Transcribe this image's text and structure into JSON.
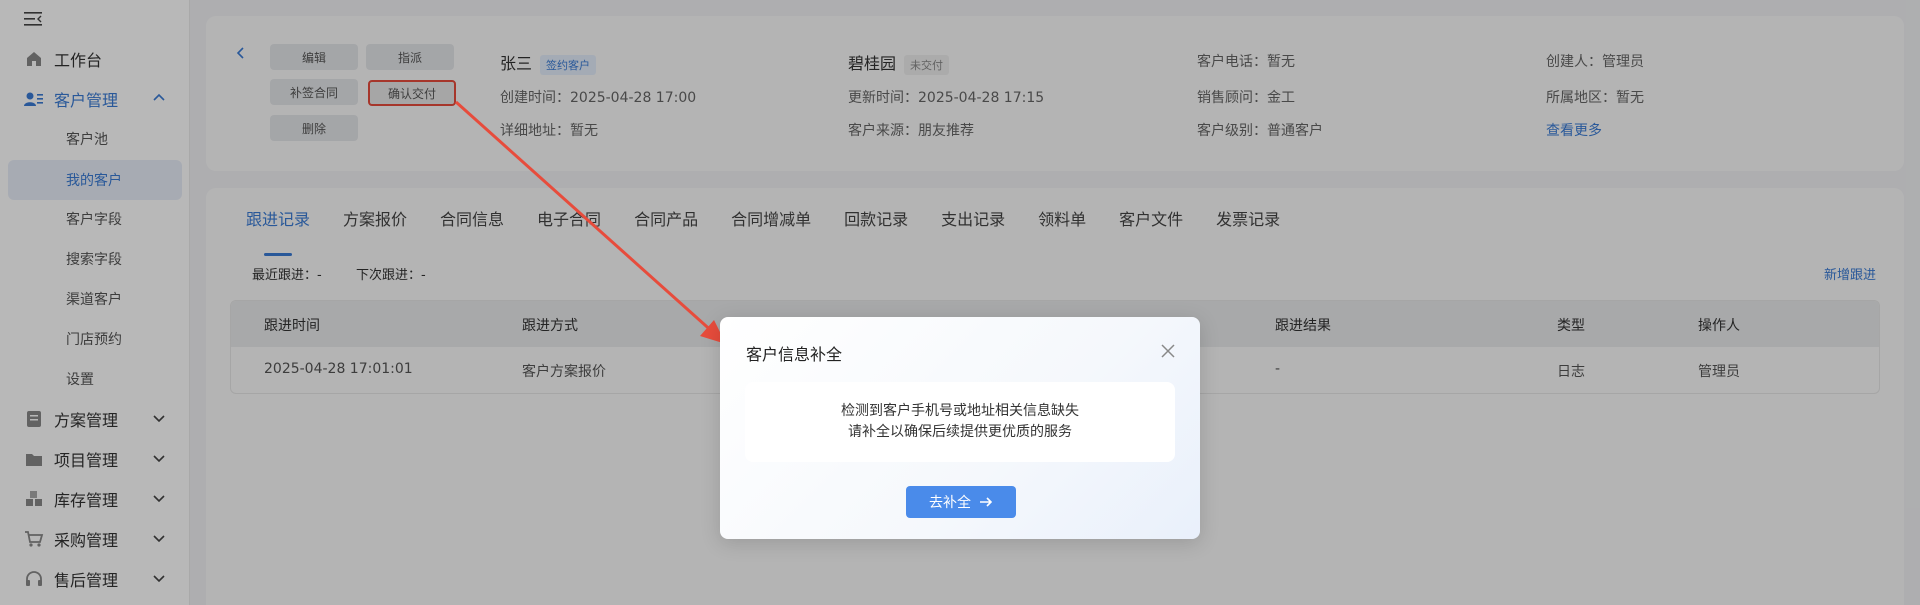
{
  "sidebar": {
    "workbench": "工作台",
    "customer_mgmt": "客户管理",
    "sub_items": [
      "客户池",
      "我的客户",
      "客户字段",
      "搜索字段",
      "渠道客户",
      "门店预约",
      "设置"
    ],
    "plan_mgmt": "方案管理",
    "project_mgmt": "项目管理",
    "inventory_mgmt": "库存管理",
    "purchase_mgmt": "采购管理",
    "after_sales_mgmt": "售后管理"
  },
  "actions": {
    "edit": "编辑",
    "assign": "指派",
    "supplement_contract": "补签合同",
    "confirm_delivery": "确认交付",
    "delete": "删除"
  },
  "customer": {
    "name": "张三",
    "name_tag": "签约客户",
    "created_label": "创建时间：",
    "created_value": "2025-04-28 17:00",
    "address_label": "详细地址：",
    "address_value": "暂无",
    "project": "碧桂园",
    "project_tag": "未交付",
    "updated_label": "更新时间：",
    "updated_value": "2025-04-28 17:15",
    "source_label": "客户来源：",
    "source_value": "朋友推荐",
    "phone_label": "客户电话：",
    "phone_value": "暂无",
    "consultant_label": "销售顾问：",
    "consultant_value": "金工",
    "level_label": "客户级别：",
    "level_value": "普通客户",
    "creator_label": "创建人：",
    "creator_value": "管理员",
    "region_label": "所属地区：",
    "region_value": "暂无",
    "more_link": "查看更多"
  },
  "tabs": [
    "跟进记录",
    "方案报价",
    "合同信息",
    "电子合同",
    "合同产品",
    "合同增减单",
    "回款记录",
    "支出记录",
    "领料单",
    "客户文件",
    "发票记录"
  ],
  "follow": {
    "recent": "最近跟进：-",
    "next": "下次跟进：-",
    "add": "新增跟进"
  },
  "table": {
    "headers": [
      "跟进时间",
      "跟进方式",
      "跟进结果",
      "类型",
      "操作人"
    ],
    "rows": [
      [
        "2025-04-28 17:01:01",
        "客户方案报价",
        "-",
        "日志",
        "管理员"
      ]
    ]
  },
  "modal": {
    "title": "客户信息补全",
    "line1": "检测到客户手机号或地址相关信息缺失",
    "line2": "请补全以确保后续提供更优质的服务",
    "button": "去补全"
  },
  "colors": {
    "primary": "#3a7bd5",
    "button": "#4a8bea",
    "annotation": "#e74c3c"
  }
}
